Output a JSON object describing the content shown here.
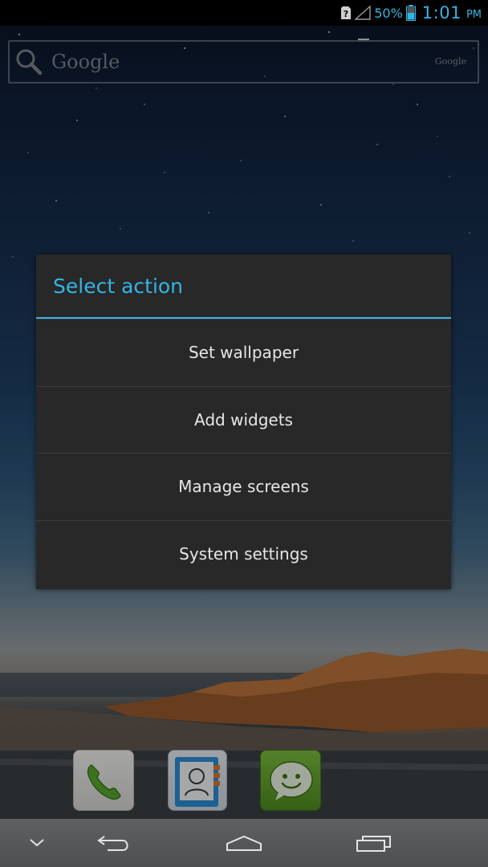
{
  "status_bar": {
    "battery_percent": "50%",
    "time": "1:01",
    "ampm": "PM",
    "icons": [
      "no-sim-icon",
      "signal-icon",
      "battery-icon"
    ],
    "accent_color": "#33b5e5"
  },
  "search_widget": {
    "label": "Google",
    "brand_small": "Google",
    "icon": "search-icon"
  },
  "dialog": {
    "title": "Select action",
    "title_color": "#33b5e5",
    "items": [
      {
        "label": "Set wallpaper"
      },
      {
        "label": "Add widgets"
      },
      {
        "label": "Manage screens"
      },
      {
        "label": "System settings"
      }
    ]
  },
  "dock": {
    "apps": [
      "phone-app-icon",
      "contacts-app-icon",
      "messaging-app-icon"
    ]
  },
  "navigation_bar": {
    "buttons": [
      "menu-chevron-icon",
      "back-icon",
      "home-icon",
      "recent-apps-icon"
    ]
  }
}
